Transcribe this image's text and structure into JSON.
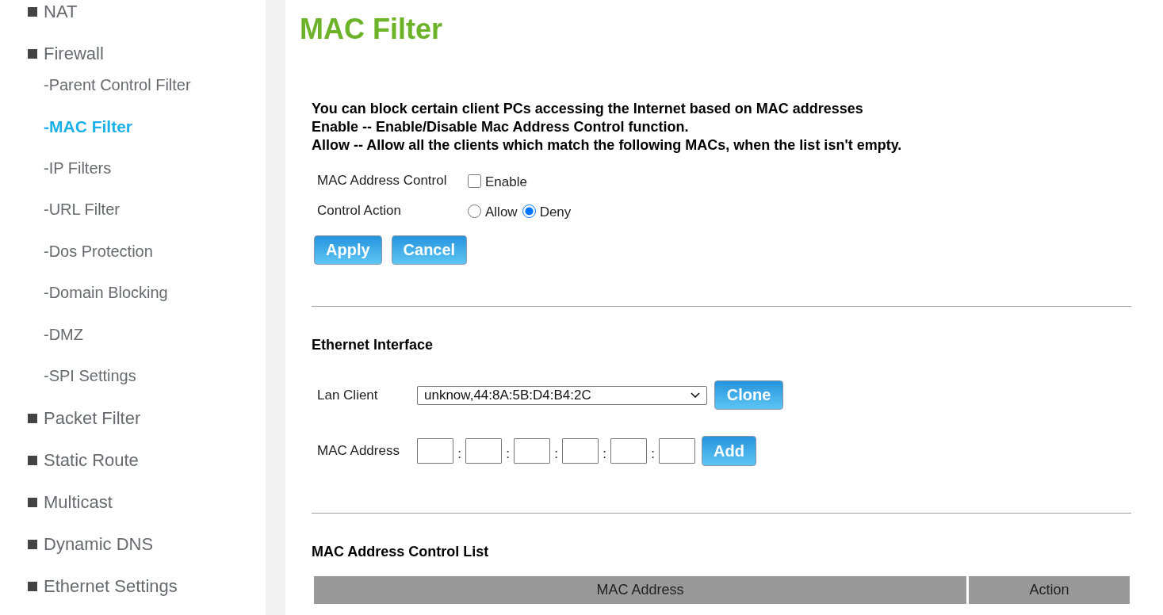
{
  "sidebar": {
    "items": [
      {
        "label": "NAT",
        "selected": false
      },
      {
        "label": "Firewall",
        "selected": false,
        "children": [
          {
            "label": "-Parent Control Filter",
            "selected": false
          },
          {
            "label": "-MAC Filter",
            "selected": true
          },
          {
            "label": "-IP Filters",
            "selected": false
          },
          {
            "label": "-URL Filter",
            "selected": false
          },
          {
            "label": "-Dos Protection",
            "selected": false
          },
          {
            "label": "-Domain Blocking",
            "selected": false
          },
          {
            "label": "-DMZ",
            "selected": false
          },
          {
            "label": "-SPI Settings",
            "selected": false
          }
        ]
      },
      {
        "label": "Packet Filter",
        "selected": false
      },
      {
        "label": "Static Route",
        "selected": false
      },
      {
        "label": "Multicast",
        "selected": false
      },
      {
        "label": "Dynamic DNS",
        "selected": false
      },
      {
        "label": "Ethernet Settings",
        "selected": false
      }
    ]
  },
  "page": {
    "title": "MAC Filter"
  },
  "intro": [
    "You can block certain client PCs accessing the Internet based on MAC addresses",
    "Enable -- Enable/Disable Mac Address Control function.",
    "Allow -- Allow all the clients which match the following MACs, when the list isn't empty."
  ],
  "settings": {
    "mac_address_control": {
      "label": "MAC Address Control",
      "option": "Enable",
      "checked": false
    },
    "control_action": {
      "label": "Control Action",
      "options": [
        {
          "label": "Allow",
          "selected": false
        },
        {
          "label": "Deny",
          "selected": true
        }
      ]
    },
    "buttons": [
      "Apply",
      "Cancel"
    ]
  },
  "ethernet_interface": {
    "heading": "Ethernet Interface",
    "lan_client": {
      "label": "Lan Client",
      "value": "unknow,44:8A:5B:D4:B4:2C",
      "button": "Clone"
    },
    "mac_address": {
      "label": "MAC Address",
      "separators": [
        ":",
        ":",
        ":",
        ":",
        ":"
      ],
      "button": "Add"
    }
  },
  "control_list": {
    "heading": "MAC Address Control List",
    "columns": [
      "MAC Address",
      "Action"
    ]
  }
}
